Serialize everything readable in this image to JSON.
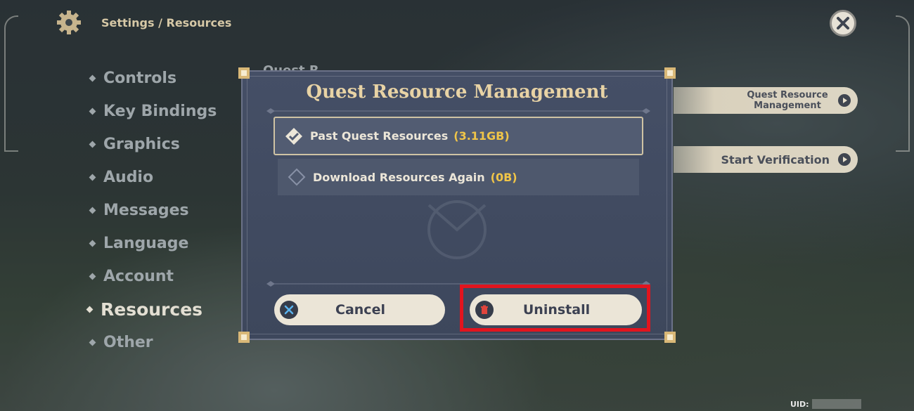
{
  "header": {
    "breadcrumb": "Settings / Resources"
  },
  "sidebar": {
    "items": [
      {
        "label": "Controls"
      },
      {
        "label": "Key Bindings"
      },
      {
        "label": "Graphics"
      },
      {
        "label": "Audio"
      },
      {
        "label": "Messages"
      },
      {
        "label": "Language"
      },
      {
        "label": "Account"
      },
      {
        "label": "Resources"
      },
      {
        "label": "Other"
      }
    ],
    "active": "Resources"
  },
  "background": {
    "section_label": "Quest R",
    "quest_resource_button": "Quest Resource Management",
    "verification_button": "Start Verification"
  },
  "dialog": {
    "title": "Quest Resource Management",
    "options": [
      {
        "label": "Past Quest Resources",
        "value": "(3.11GB)",
        "selected": true
      },
      {
        "label": "Download Resources Again",
        "value": "(0B)",
        "selected": false
      }
    ],
    "cancel_label": "Cancel",
    "uninstall_label": "Uninstall"
  },
  "footer": {
    "uid_label": "UID:"
  },
  "colors": {
    "accent_gold": "#e8d3a5",
    "value_yellow": "#f0c548",
    "highlight_red": "#e2141e",
    "button_cream": "#ebe5d7"
  }
}
